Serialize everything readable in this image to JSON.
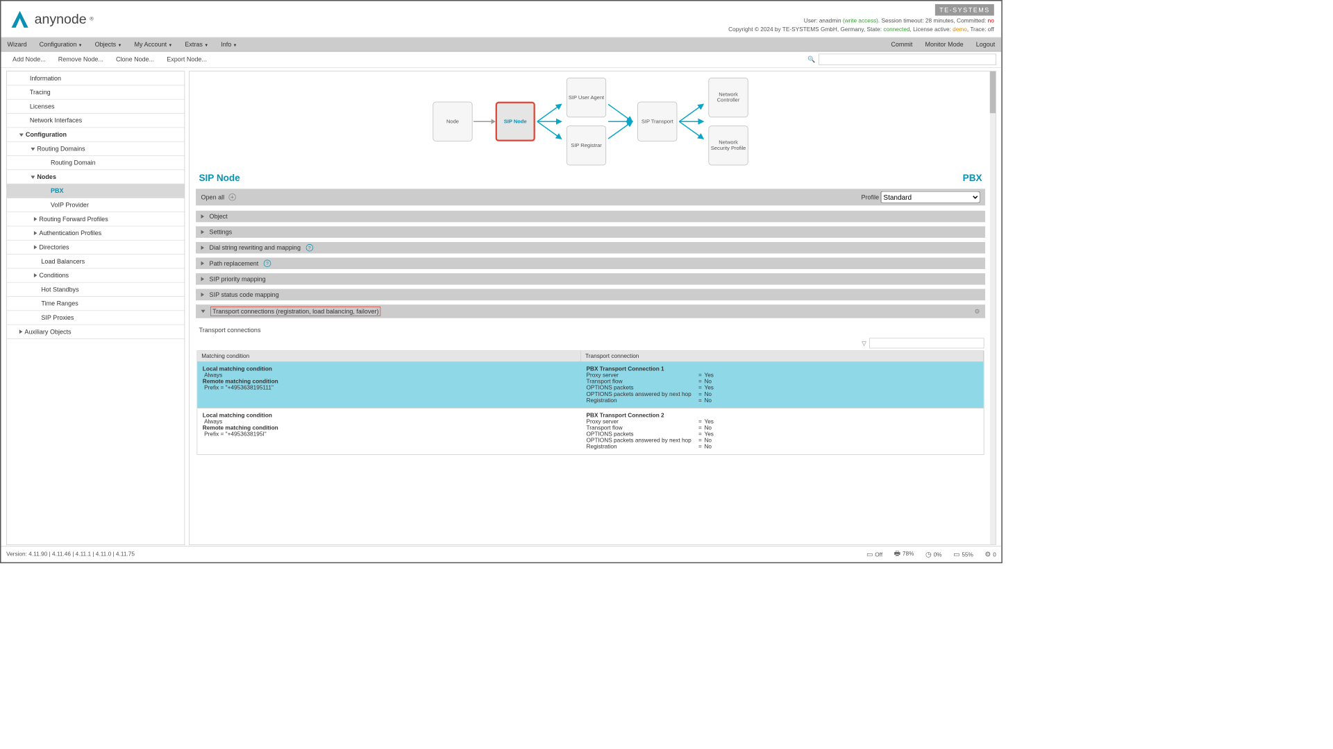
{
  "brand": {
    "name": "anynode",
    "reg": "®"
  },
  "header": {
    "te_logo": "TE-SYSTEMS",
    "line1_user": "User:",
    "line1_user_v": "anadmin",
    "line1_access": "(write access)",
    "line1_sess": ". Session timeout:",
    "line1_sess_v": "28 minutes",
    "line1_comm": ", Committed:",
    "line1_comm_v": "no",
    "line2_a": "Copyright © 2024 by TE-SYSTEMS GmbH, Germany, State:",
    "line2_state": "connected",
    "line2_b": ", License active:",
    "line2_lic": "demo",
    "line2_c": ", Trace:",
    "line2_trace": "off"
  },
  "menu": {
    "wizard": "Wizard",
    "config": "Configuration",
    "objects": "Objects",
    "account": "My Account",
    "extras": "Extras",
    "info": "Info",
    "commit": "Commit",
    "monitor": "Monitor Mode",
    "logout": "Logout"
  },
  "toolbar": {
    "add": "Add Node...",
    "remove": "Remove Node...",
    "clone": "Clone Node...",
    "export": "Export Node..."
  },
  "sidebar": {
    "information": "Information",
    "tracing": "Tracing",
    "licenses": "Licenses",
    "netif": "Network Interfaces",
    "config": "Configuration",
    "rdomains": "Routing Domains",
    "rdomain": "Routing Domain",
    "nodes": "Nodes",
    "pbx": "PBX",
    "voip": "VoIP Provider",
    "rfp": "Routing Forward Profiles",
    "auth": "Authentication Profiles",
    "dirs": "Directories",
    "lb": "Load Balancers",
    "cond": "Conditions",
    "hot": "Hot Standbys",
    "tr": "Time Ranges",
    "sipp": "SIP Proxies",
    "aux": "Auxiliary Objects"
  },
  "diagram": {
    "node": "Node",
    "sip": "SIP Node",
    "ua": "SIP User Agent",
    "reg": "SIP Registrar",
    "tr": "SIP Transport",
    "nc": "Network Controller",
    "nsp": "Network Security Profile"
  },
  "titles": {
    "left": "SIP Node",
    "right": "PBX"
  },
  "openall": {
    "label": "Open all",
    "profile": "Profile",
    "profile_v": "Standard"
  },
  "acc": {
    "obj": "Object",
    "set": "Settings",
    "dial": "Dial string rewriting and mapping",
    "path": "Path replacement",
    "prio": "SIP priority mapping",
    "status": "SIP status code mapping",
    "tc": "Transport connections (registration, load balancing, failover)"
  },
  "tc": {
    "sub": "Transport connections",
    "hA": "Matching condition",
    "hB": "Transport connection"
  },
  "rows": [
    {
      "local_t": "Local matching condition",
      "local_v": "Always",
      "remote_t": "Remote matching condition",
      "remote_v": "Prefix = \"+4953638195111\"",
      "name": "PBX Transport Connection 1",
      "kv": [
        [
          "Proxy server",
          "Yes"
        ],
        [
          "Transport flow",
          "No"
        ],
        [
          "OPTIONS packets",
          "Yes"
        ],
        [
          "OPTIONS packets answered by next hop",
          "No"
        ],
        [
          "Registration",
          "No"
        ]
      ]
    },
    {
      "local_t": "Local matching condition",
      "local_v": "Always",
      "remote_t": "Remote matching condition",
      "remote_v": "Prefix = \"+4953638195I\"",
      "name": "PBX Transport Connection 2",
      "kv": [
        [
          "Proxy server",
          "Yes"
        ],
        [
          "Transport flow",
          "No"
        ],
        [
          "OPTIONS packets",
          "Yes"
        ],
        [
          "OPTIONS packets answered by next hop",
          "No"
        ],
        [
          "Registration",
          "No"
        ]
      ]
    }
  ],
  "footer": {
    "ver": "Version: 4.11.90 | 4.11.46 | 4.11.1 | 4.11.0 | 4.11.75",
    "s1": "Off",
    "s2": "78%",
    "s3": "0%",
    "s4": "55%",
    "s5": "0"
  }
}
